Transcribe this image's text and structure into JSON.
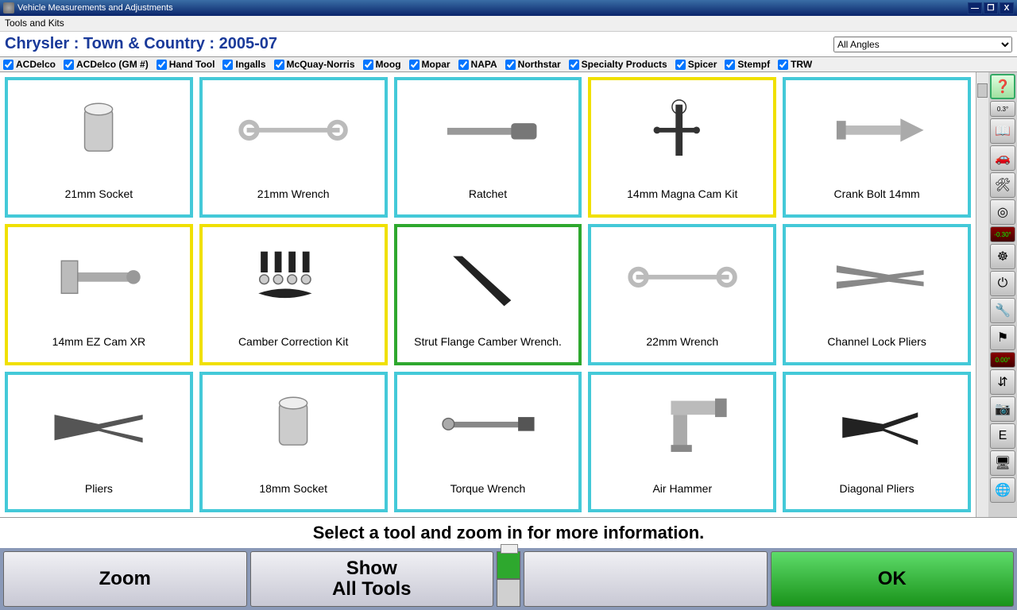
{
  "window": {
    "title": "Vehicle Measurements and Adjustments"
  },
  "menu": {
    "tools_kits": "Tools and Kits"
  },
  "header": {
    "vehicle": "Chrysler : Town & Country : 2005-07",
    "angle_select": "All Angles"
  },
  "filters": [
    {
      "label": "ACDelco",
      "checked": true
    },
    {
      "label": "ACDelco (GM #)",
      "checked": true
    },
    {
      "label": "Hand Tool",
      "checked": true
    },
    {
      "label": "Ingalls",
      "checked": true
    },
    {
      "label": "McQuay-Norris",
      "checked": true
    },
    {
      "label": "Moog",
      "checked": true
    },
    {
      "label": "Mopar",
      "checked": true
    },
    {
      "label": "NAPA",
      "checked": true
    },
    {
      "label": "Northstar",
      "checked": true
    },
    {
      "label": "Specialty Products",
      "checked": true
    },
    {
      "label": "Spicer",
      "checked": true
    },
    {
      "label": "Stempf",
      "checked": true
    },
    {
      "label": "TRW",
      "checked": true
    }
  ],
  "tools": [
    {
      "label": "21mm Socket",
      "color": "cyan",
      "icon": "socket"
    },
    {
      "label": "21mm Wrench",
      "color": "cyan",
      "icon": "wrench"
    },
    {
      "label": "Ratchet",
      "color": "cyan",
      "icon": "ratchet"
    },
    {
      "label": "14mm Magna Cam Kit",
      "color": "yellow",
      "icon": "kit"
    },
    {
      "label": "Crank Bolt 14mm",
      "color": "cyan",
      "icon": "bolt"
    },
    {
      "label": "14mm EZ Cam XR",
      "color": "yellow",
      "icon": "cam"
    },
    {
      "label": "Camber Correction Kit",
      "color": "yellow",
      "icon": "bolts-kit"
    },
    {
      "label": "Strut Flange Camber Wrench.",
      "color": "green",
      "icon": "hex-wrench"
    },
    {
      "label": "22mm Wrench",
      "color": "cyan",
      "icon": "wrench"
    },
    {
      "label": "Channel Lock Pliers",
      "color": "cyan",
      "icon": "channel-pliers"
    },
    {
      "label": "Pliers",
      "color": "cyan",
      "icon": "pliers"
    },
    {
      "label": "18mm Socket",
      "color": "cyan",
      "icon": "socket"
    },
    {
      "label": "Torque Wrench",
      "color": "cyan",
      "icon": "torque"
    },
    {
      "label": "Air Hammer",
      "color": "cyan",
      "icon": "air-hammer"
    },
    {
      "label": "Diagonal Pliers",
      "color": "cyan",
      "icon": "diag-pliers"
    }
  ],
  "hint": "Select a tool and zoom in for more information.",
  "buttons": {
    "zoom": "Zoom",
    "show_all": "Show\nAll Tools",
    "ok": "OK"
  },
  "side_labels": {
    "angle_small": "0.3°",
    "neg_green": "-0.30°",
    "zero_red": "0.00°"
  }
}
